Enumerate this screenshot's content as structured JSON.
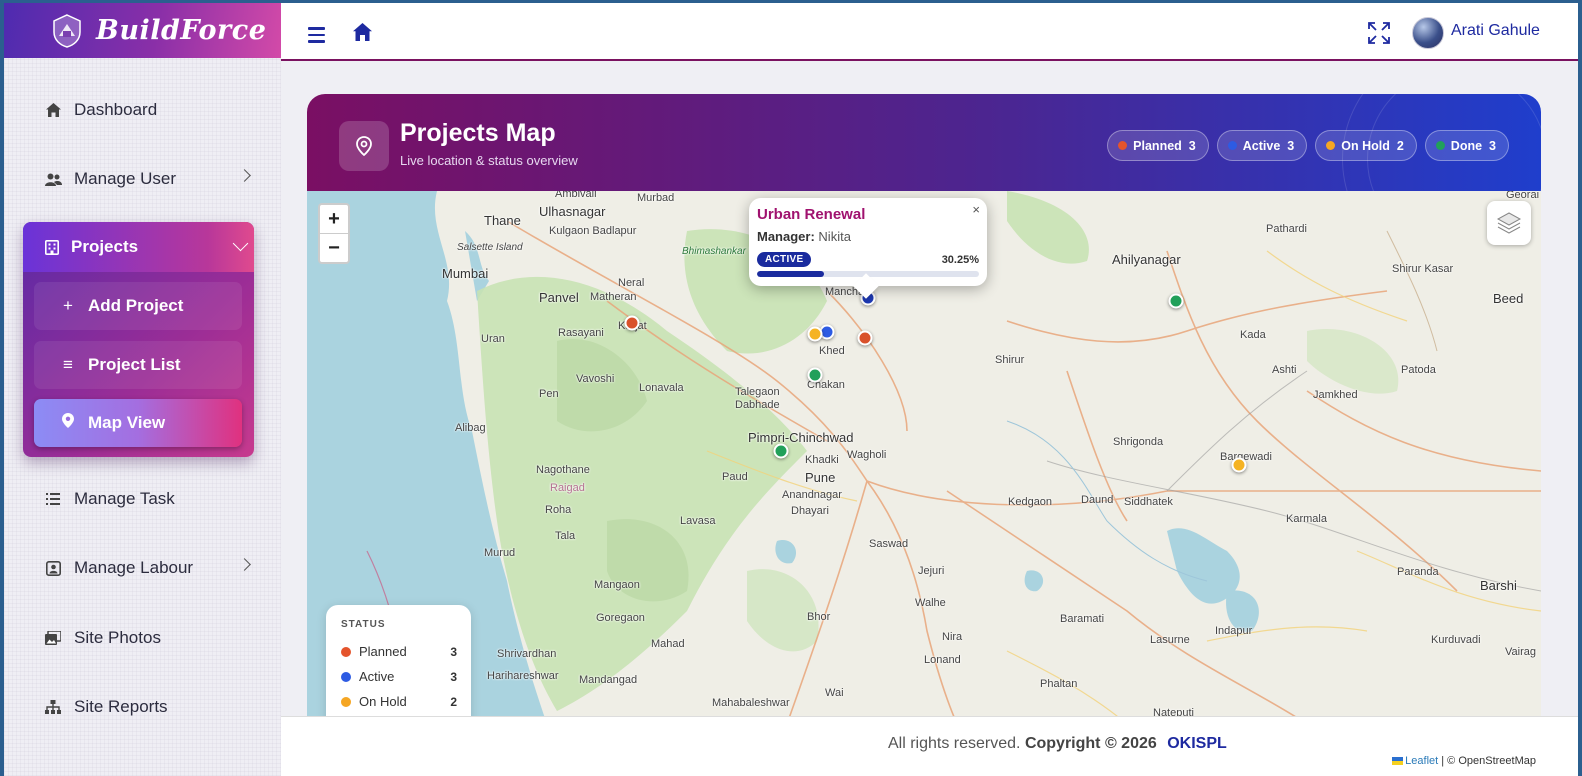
{
  "brand": {
    "name": "BuildForce"
  },
  "sidebar": {
    "items": [
      {
        "label": "Dashboard",
        "icon": "home-icon"
      },
      {
        "label": "Manage User",
        "icon": "users-icon"
      },
      {
        "label": "Projects",
        "icon": "building-icon"
      },
      {
        "label": "Manage Task",
        "icon": "list-icon"
      },
      {
        "label": "Manage Labour",
        "icon": "labour-icon"
      },
      {
        "label": "Site Photos",
        "icon": "photo-icon"
      },
      {
        "label": "Site Reports",
        "icon": "sitemap-icon"
      }
    ],
    "projects_sub": [
      {
        "label": "Add Project",
        "symbol": "+"
      },
      {
        "label": "Project List",
        "symbol": "≡"
      },
      {
        "label": "Map View",
        "symbol": "pin"
      }
    ]
  },
  "topbar": {
    "user_name": "Arati Gahule"
  },
  "header": {
    "title": "Projects Map",
    "subtitle": "Live location & status overview",
    "chips": [
      {
        "label": "Planned",
        "count": "3",
        "color": "#e4542c"
      },
      {
        "label": "Active",
        "count": "3",
        "color": "#2d5be3"
      },
      {
        "label": "On Hold",
        "count": "2",
        "color": "#f5a623"
      },
      {
        "label": "Done",
        "count": "3",
        "color": "#21a05a"
      }
    ]
  },
  "map": {
    "zoom_in": "+",
    "zoom_out": "−",
    "places": [
      "Ambivali",
      "Murbad",
      "Thane",
      "Ulhasnagar",
      "Kulgaon Badlapur",
      "Salsette Island",
      "Mumbai",
      "Panvel",
      "Matheran",
      "Neral",
      "Karjat",
      "Uran",
      "Rasayani",
      "Vavoshi",
      "Lonavala",
      "Pen",
      "Alibag",
      "Nagothane",
      "Raigad",
      "Roha",
      "Murud",
      "Tala",
      "Mangaon",
      "Goregaon",
      "Mahad",
      "Shrivardhan",
      "Harihareshwar",
      "Mandangad",
      "Mahabaleshwar",
      "Wai",
      "Bhimashankar Wildlife Sanctuary",
      "Manchar",
      "Khed",
      "Chakan",
      "Talegaon Dabhade",
      "Pimpri-Chinchwad",
      "Khadki",
      "Wagholi",
      "Paud",
      "Pune",
      "Anandnagar",
      "Dhayari",
      "Lavasa",
      "Saswad",
      "Jejuri",
      "Walhe",
      "Bhor",
      "Nira",
      "Lonand",
      "Phaltan",
      "Shirur",
      "Shrigonda",
      "Kedgaon",
      "Daund",
      "Siddhatek",
      "Baramati",
      "Lasurne",
      "Indapur",
      "Nateputi",
      "Bargewadi",
      "Karmala",
      "Paranda",
      "Barshi",
      "Kurduvadi",
      "Vairag",
      "Ahilyanagar",
      "Pathardi",
      "Shirur Kasar",
      "Beed",
      "Kada",
      "Ashti",
      "Patoda",
      "Jamkhed",
      "Georai"
    ],
    "markers": [
      {
        "status": "Planned",
        "color": "#d9512b"
      },
      {
        "status": "Planned",
        "color": "#d9512b"
      },
      {
        "status": "Active",
        "color": "#2d5be3"
      },
      {
        "status": "Active",
        "color": "#1f3bb8"
      },
      {
        "status": "On Hold",
        "color": "#f5b323"
      },
      {
        "status": "On Hold",
        "color": "#f5b323"
      },
      {
        "status": "Done",
        "color": "#21a05a"
      },
      {
        "status": "Done",
        "color": "#21a05a"
      },
      {
        "status": "Done",
        "color": "#21a05a"
      }
    ],
    "popup": {
      "title": "Urban Renewal",
      "manager_label": "Manager:",
      "manager": "Nikita",
      "status": "ACTIVE",
      "progress_text": "30.25%",
      "progress": 30.25
    },
    "legend": {
      "title": "STATUS",
      "rows": [
        {
          "label": "Planned",
          "count": "3",
          "color": "#e4542c"
        },
        {
          "label": "Active",
          "count": "3",
          "color": "#2d5be3"
        },
        {
          "label": "On Hold",
          "count": "2",
          "color": "#f5a623"
        }
      ]
    },
    "attribution": {
      "leaflet": "Leaflet",
      "osm": "| © OpenStreetMap"
    }
  },
  "footer": {
    "text": "All rights reserved.",
    "copyright": "Copyright © 2026",
    "company": "OKISPL"
  }
}
